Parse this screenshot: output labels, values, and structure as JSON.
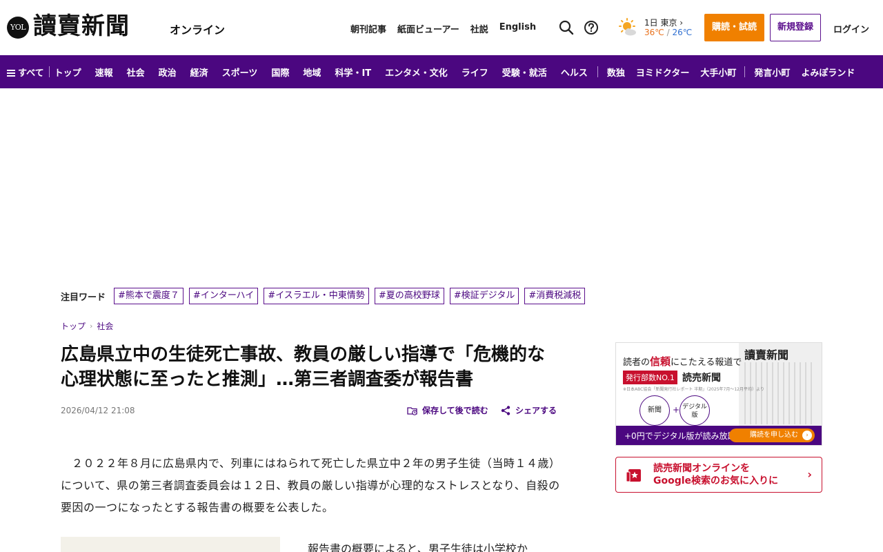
{
  "header": {
    "logo_badge": "YOL",
    "logo_text": "讀賣新聞",
    "logo_sub": "オンライン",
    "links": [
      "朝刊記事",
      "紙面ビューアー",
      "社説",
      "English"
    ],
    "weather": {
      "location": "1日 東京",
      "high": "36℃",
      "separator": "/",
      "low": "26℃"
    },
    "subscribe_label": "購読・試読",
    "register_label": "新規登録",
    "login_label": "ログイン"
  },
  "nav": {
    "all_label": "すべて",
    "items_a": [
      "トップ",
      "速報",
      "社会",
      "政治",
      "経済",
      "スポーツ",
      "国際",
      "地域",
      "科学・IT",
      "エンタメ・文化",
      "ライフ",
      "受験・就活",
      "ヘルス"
    ],
    "items_b": [
      "数独",
      "ヨミドクター",
      "大手小町"
    ],
    "items_c": [
      "発言小町",
      "よみぽランド"
    ]
  },
  "trend": {
    "label": "注目ワード",
    "tags": [
      "#熊本で震度７",
      "#インターハイ",
      "#イスラエル・中東情勢",
      "#夏の高校野球",
      "#検証デジタル",
      "#消費税減税"
    ]
  },
  "breadcrumb": {
    "top": "トップ",
    "section": "社会"
  },
  "article": {
    "title": "広島県立中の生徒死亡事故、教員の厳しい指導で「危機的な心理状態に至ったと推測」…第三者調査委が報告書",
    "date": "2026/04/12 21:08",
    "save_label": "保存して後で読む",
    "share_label": "シェアする",
    "lead": "２０２２年８月に広島県内で、列車にはねられて死亡した県立中２年の男子生徒（当時１４歳）について、県の第三者調査委員会は１２日、教員の厳しい指導が心理的なストレスとなり、自殺の要因の一つになったとする報告書の概要を公表した。",
    "body_start": "報告書の概要によると、男子生徒は小学校か"
  },
  "ad": {
    "headline_pre": "読者の",
    "headline_em": "信頼",
    "headline_post": "にこたえる報道で",
    "badge": "発行部数NO.1",
    "brand": "読売新聞",
    "note": "※日本ABC協会「新聞発行社レポート 半期」（2025年7月〜12月平均）より",
    "newspaper_title": "讀賣新聞",
    "circle_1": "新聞",
    "circle_2": "デジタル版",
    "bar_text": "+0円でデジタル版が読み放題!",
    "cta": "購読を申し込む"
  },
  "google_promo": {
    "line1": "読売新聞オンラインを",
    "line2": "Google検索のお気に入りに"
  },
  "colors": {
    "brand_purple": "#4b0780",
    "accent_orange": "#f08000",
    "accent_red": "#c8102e"
  }
}
